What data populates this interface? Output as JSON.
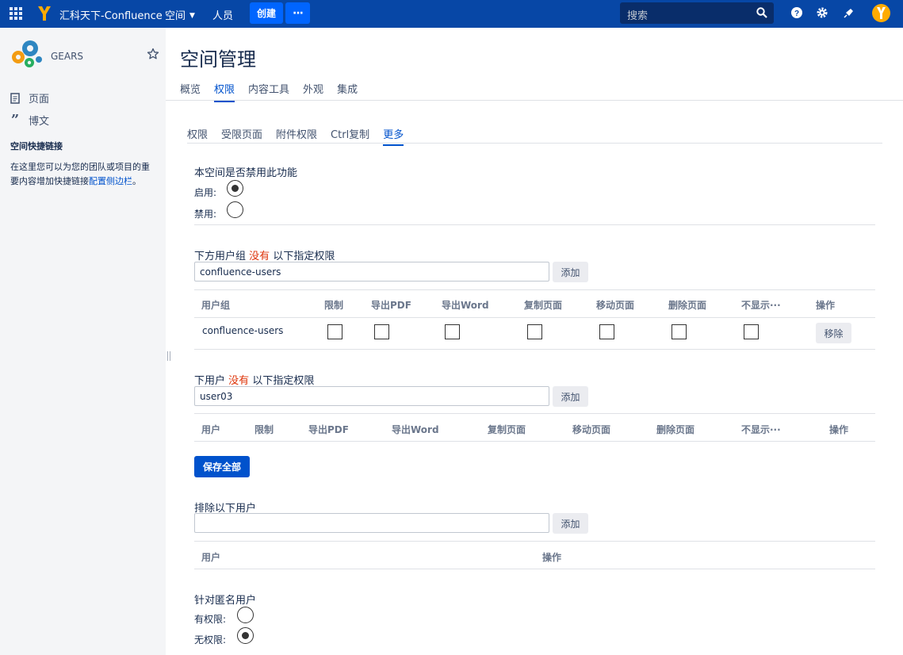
{
  "topbar": {
    "app_title": "汇科天下-Confluence",
    "nav_spaces": "空间",
    "nav_people": "人员",
    "create_label": "创建",
    "more_label": "···",
    "search_placeholder": "搜索",
    "brand_color": "#0747a6"
  },
  "sidebar": {
    "space_name": "GEARS",
    "pages_label": "页面",
    "blog_label": "博文",
    "shortcuts_title": "空间快捷链接",
    "shortcuts_desc_before": "在这里您可以为您的团队或项目的重要内容增加快捷链接",
    "shortcuts_link": "配置侧边栏",
    "shortcuts_desc_after": "。"
  },
  "page": {
    "title": "空间管理",
    "main_tabs": [
      "概览",
      "权限",
      "内容工具",
      "外观",
      "集成"
    ],
    "main_tab_active": "权限",
    "sub_tabs": [
      "权限",
      "受限页面",
      "附件权限",
      "Ctrl复制",
      "更多"
    ],
    "sub_tab_active": "更多"
  },
  "feature_section": {
    "question": "本空间是否禁用此功能",
    "enable_label": "启用:",
    "disable_label": "禁用:",
    "selected": "enable"
  },
  "group_section": {
    "heading_before": "下方用户组",
    "heading_emph": "没有",
    "heading_after": "以下指定权限",
    "input_value": "confluence-users",
    "add_label": "添加",
    "columns": [
      "用户组",
      "限制",
      "导出PDF",
      "导出Word",
      "复制页面",
      "移动页面",
      "删除页面",
      "不显示···",
      "操作"
    ],
    "rows": [
      {
        "name": "confluence-users",
        "checks": [
          false,
          false,
          false,
          false,
          false,
          false,
          false
        ],
        "action": "移除"
      }
    ]
  },
  "user_section": {
    "heading_before": "下用户",
    "heading_emph": "没有",
    "heading_after": "以下指定权限",
    "input_value": "user03",
    "add_label": "添加",
    "columns": [
      "用户",
      "限制",
      "导出PDF",
      "导出Word",
      "复制页面",
      "移动页面",
      "删除页面",
      "不显示···",
      "操作"
    ]
  },
  "save_all_label": "保存全部",
  "exclude_section": {
    "heading": "排除以下用户",
    "input_value": "",
    "add_label": "添加",
    "columns": [
      "用户",
      "操作"
    ]
  },
  "anonymous_section": {
    "heading": "针对匿名用户",
    "has_label": "有权限:",
    "no_label": "无权限:",
    "selected": "no"
  }
}
